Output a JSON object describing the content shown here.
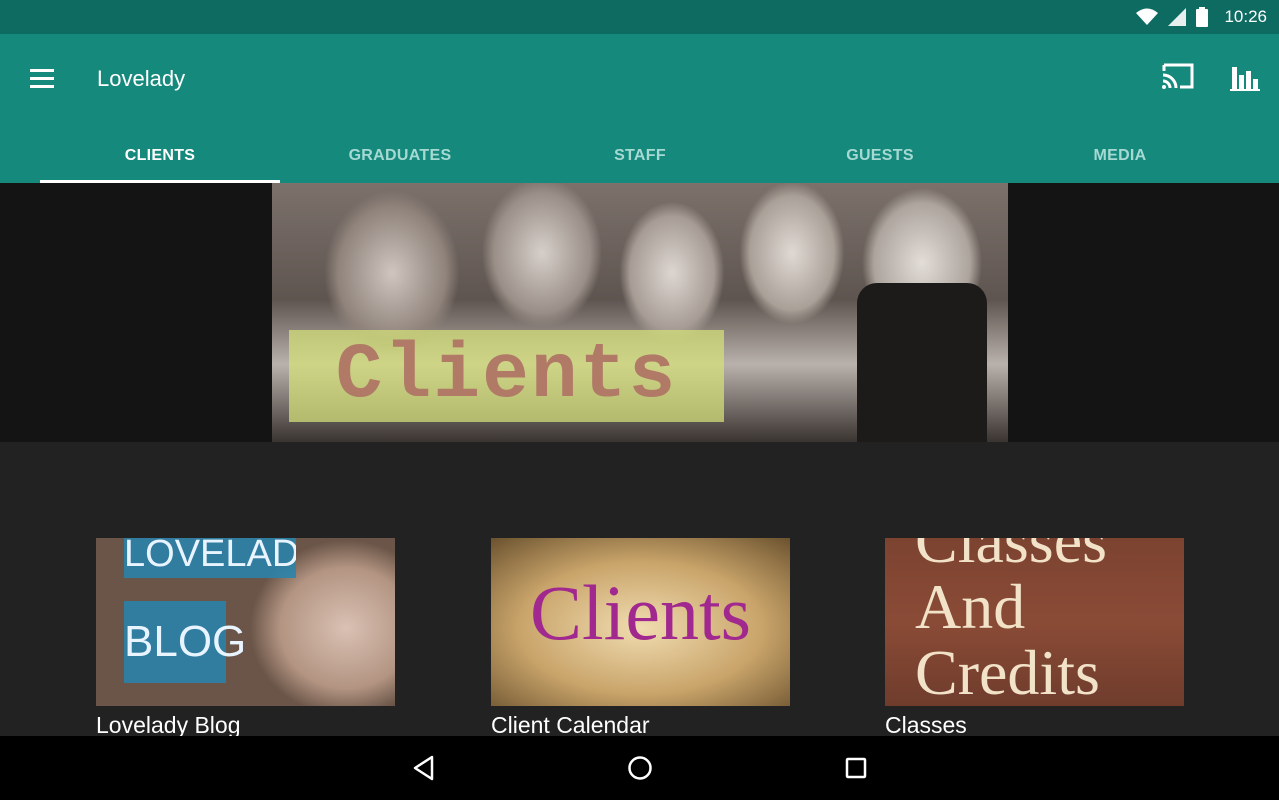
{
  "status_bar": {
    "time": "10:26",
    "icons": [
      "wifi-icon",
      "cell-signal-icon",
      "battery-icon"
    ]
  },
  "app_bar": {
    "title": "Lovelady",
    "menu_icon": "hamburger-menu-icon",
    "actions": [
      "cast-icon",
      "bar-chart-icon"
    ],
    "background": "#16897d",
    "status_background": "#0e6b62"
  },
  "tabs": [
    {
      "label": "CLIENTS",
      "active": true
    },
    {
      "label": "GRADUATES",
      "active": false
    },
    {
      "label": "STAFF",
      "active": false
    },
    {
      "label": "GUESTS",
      "active": false
    },
    {
      "label": "MEDIA",
      "active": false
    }
  ],
  "hero": {
    "overlay_text": "Clients"
  },
  "cards": [
    {
      "caption": "Lovelady Blog",
      "image_text_top": "LOVELADY",
      "image_text_bottom": "BLOG"
    },
    {
      "caption": "Client Calendar",
      "image_text": "Clients"
    },
    {
      "caption": "Classes",
      "image_text": "Classes And Credits"
    }
  ],
  "nav_bar": {
    "buttons": [
      "back-icon",
      "home-icon",
      "recents-icon"
    ]
  }
}
